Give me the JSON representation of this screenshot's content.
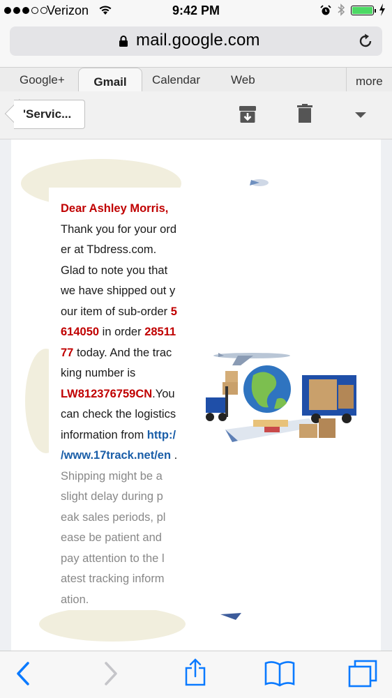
{
  "status_bar": {
    "carrier": "Verizon",
    "time": "9:42 PM",
    "signal_bars": 3,
    "battery_level": 1.0,
    "icons": [
      "signal-dots-icon",
      "wifi-icon",
      "alarm-icon",
      "bluetooth-icon",
      "battery-icon",
      "charging-bolt-icon"
    ]
  },
  "browser": {
    "url": "mail.google.com",
    "lock_icon": "lock-icon",
    "reload_icon": "reload-icon"
  },
  "google_tabs": {
    "items": [
      "Google+",
      "Gmail",
      "Calendar",
      "Web"
    ],
    "active": "Gmail",
    "more_label": "more"
  },
  "gmail_toolbar": {
    "back_label": "'Servic...",
    "actions": [
      "archive-icon",
      "trash-icon",
      "more-caret-icon"
    ]
  },
  "email": {
    "greeting": "Dear Ashley Morris,",
    "l1": "Thank you for your ord",
    "l2": "er at Tbdress.com.",
    "l3": "Glad to note you that",
    "l4": "we have shipped out y",
    "l5a": "our item of sub-order ",
    "l5b": "5",
    "l6a": "614050",
    "l6b": " in order ",
    "l6c": "28511",
    "l7a": "77",
    "l7b": " today. And the trac",
    "l8": "king number is",
    "l9a": "LW812376759CN",
    "l9b": ".You",
    "l10": "can check the logistics",
    "l11a": "information from ",
    "l11b": "http:/",
    "l12a": "/www.17track.net/en",
    "l12b": " .",
    "l13": "Shipping might be a",
    "l14": "slight delay during p",
    "l15": "eak sales periods, pl",
    "l16": "ease be patient and",
    "l17": "pay attention to the l",
    "l18": "atest tracking inform",
    "l19": "ation.",
    "accent_color": "#c00000",
    "link_color": "#1a5ea8"
  },
  "safari_toolbar": {
    "buttons": [
      "back-icon",
      "forward-icon",
      "share-icon",
      "bookmarks-icon",
      "tabs-icon"
    ],
    "tint_color": "#0a7aff"
  }
}
